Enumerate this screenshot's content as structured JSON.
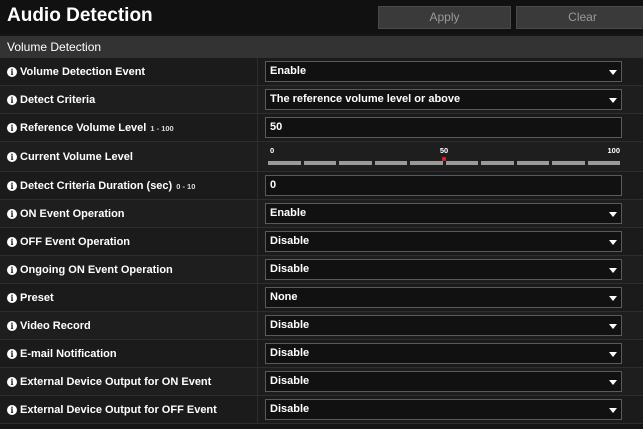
{
  "header": {
    "title": "Audio Detection",
    "apply_label": "Apply",
    "clear_label": "Clear"
  },
  "section": {
    "title": "Volume Detection"
  },
  "rows": {
    "volume_detection_event": {
      "label": "Volume Detection Event",
      "value": "Enable"
    },
    "detect_criteria": {
      "label": "Detect Criteria",
      "value": "The reference volume level or above"
    },
    "reference_volume_level": {
      "label": "Reference Volume Level",
      "range": "1 - 100",
      "value": "50"
    },
    "current_volume_level": {
      "label": "Current Volume Level",
      "scale_min": "0",
      "scale_mid": "50",
      "scale_max": "100",
      "current_level": 0.5,
      "segments": 10
    },
    "detect_criteria_duration": {
      "label": "Detect Criteria Duration (sec)",
      "range": "0 - 10",
      "value": "0"
    },
    "on_event_operation": {
      "label": "ON Event Operation",
      "value": "Enable"
    },
    "off_event_operation": {
      "label": "OFF Event Operation",
      "value": "Disable"
    },
    "ongoing_on_event_operation": {
      "label": "Ongoing ON Event Operation",
      "value": "Disable"
    },
    "preset": {
      "label": "Preset",
      "value": "None"
    },
    "video_record": {
      "label": "Video Record",
      "value": "Disable"
    },
    "email_notification": {
      "label": "E-mail Notification",
      "value": "Disable"
    },
    "external_on": {
      "label": "External Device Output for ON Event",
      "value": "Disable"
    },
    "external_off": {
      "label": "External Device Output for OFF Event",
      "value": "Disable"
    }
  },
  "colors": {
    "meter_marker": "#e02020",
    "meter_segment": "#9a9a9a"
  },
  "icons": {
    "info": "info-icon",
    "dropdown": "chevron-down-icon"
  }
}
